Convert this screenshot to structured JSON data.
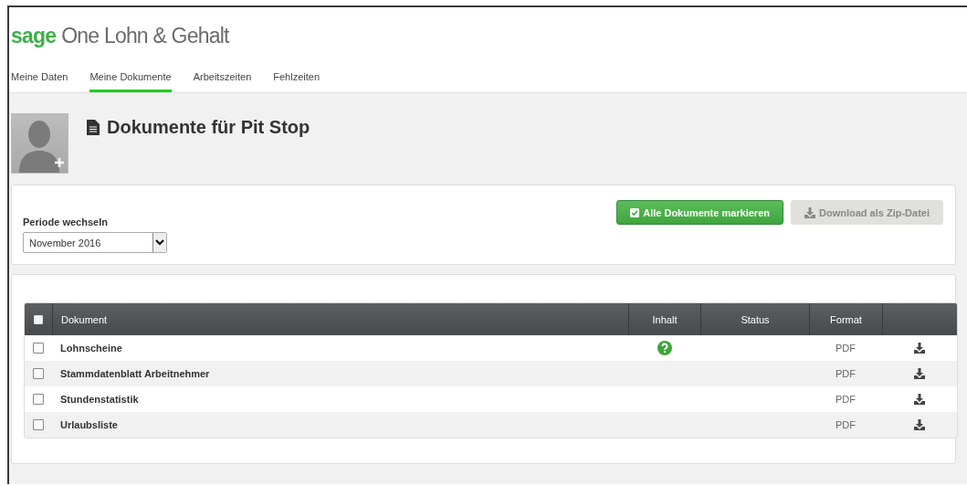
{
  "logo": {
    "brand": "sage",
    "product": "One Lohn & Gehalt"
  },
  "tabs": [
    {
      "label": "Meine Daten",
      "selected": false
    },
    {
      "label": "Meine Dokumente",
      "selected": true
    },
    {
      "label": "Arbeitszeiten",
      "selected": false
    },
    {
      "label": "Fehlzeiten",
      "selected": false
    }
  ],
  "page_title": "Dokumente für Pit Stop",
  "period": {
    "label": "Periode wechseln",
    "value": "November 2016"
  },
  "buttons": [
    {
      "label": "Alle Dokumente markieren",
      "kind": "select-all",
      "disabled": false
    },
    {
      "label": "Download als Zip-Datei",
      "kind": "download",
      "disabled": true
    }
  ],
  "table": {
    "select_all_checked": false,
    "columns": [
      "Dokument",
      "Inhalt",
      "Status",
      "Format"
    ],
    "rows": [
      {
        "checked": false,
        "name": "Lohnscheine",
        "inhalt_help": true,
        "format": "PDF"
      },
      {
        "checked": false,
        "name": "Stammdatenblatt Arbeitnehmer",
        "inhalt_help": false,
        "format": "PDF"
      },
      {
        "checked": false,
        "name": "Stundenstatistik",
        "inhalt_help": false,
        "format": "PDF"
      },
      {
        "checked": false,
        "name": "Urlaubsliste",
        "inhalt_help": false,
        "format": "PDF"
      }
    ]
  }
}
